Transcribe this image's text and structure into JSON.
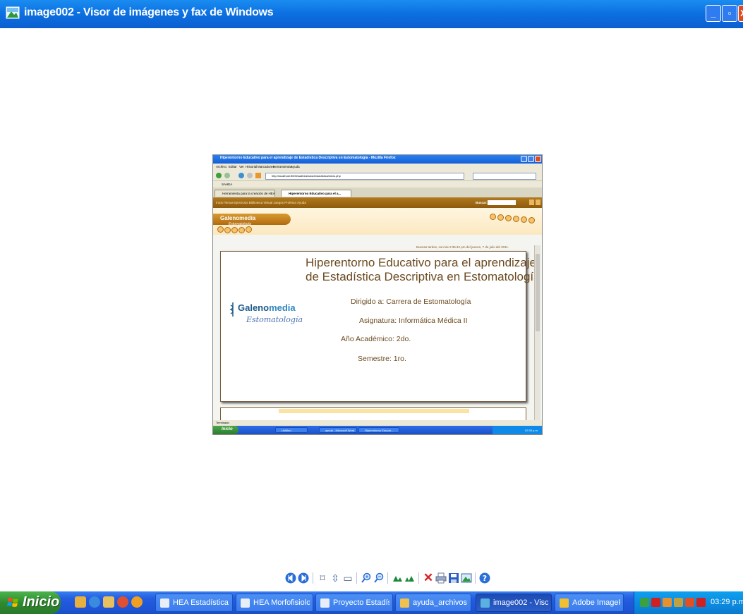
{
  "window": {
    "title": "image002 - Visor de imágenes y fax de Windows",
    "min_label": "_",
    "max_label": "▫",
    "close_label": "X"
  },
  "preview": {
    "firefox_title": "Hiperentorno Educativo para el aprendizaje de Estadística Descriptiva en Estomatología - Mozilla Firefox",
    "menu": [
      "Archivo",
      "Editar",
      "Ver",
      "Historial",
      "Marcadores",
      "Herramientas",
      "Ayuda"
    ],
    "url": "http://localhost:5000/sadhea/www/estadistica/inicio.php",
    "bookmark": "SAHEA",
    "tabs": [
      "Herramienta para la creación de HEA",
      "Hiperentorno Educativo para el a..."
    ],
    "site_nav": "Inicio   Temas   Ejercicios   Biblioteca Virtual   Juegos   Profesor   Ayuda",
    "search_label": "Buscar:",
    "header_logo": "Galenomedia",
    "header_sub": "Estomatología",
    "greeting": "Buenas tardes, son las 2:35:42 pm del jueves, 7 de julio del 2011.",
    "main_title_1": "Hiperentorno Educativo para el aprendizaje",
    "main_title_2": "de Estadística Descriptiva en Estomatología",
    "logo_galeno": "Galeno",
    "logo_media": "media",
    "logo_sub": "Estomatología",
    "dirigido": "Dirigido a: Carrera de Estomatología",
    "asignatura": "Asignatura: Informática Médica II",
    "anio": "Año Académico: 2do.",
    "semestre": "Semestre: 1ro.",
    "status": "Terminado",
    "inner_start": "Inicio",
    "inner_tasks": [
      "Untitled",
      "ayuda - Microsoft Word",
      "Hiperentorno Educat..."
    ],
    "inner_clock": "02:35 p.m."
  },
  "toolbar": {
    "icons": [
      "previous-image-icon",
      "next-image-icon",
      "best-fit-icon",
      "actual-size-icon",
      "slideshow-icon",
      "zoom-in-icon",
      "zoom-out-icon",
      "rotate-clockwise-icon",
      "rotate-counterclockwise-icon",
      "delete-icon",
      "print-icon",
      "save-icon",
      "edit-icon",
      "help-icon"
    ]
  },
  "taskbar": {
    "start_label": "Inicio",
    "tasks": [
      "HEA Estadística ...",
      "HEA Morfofisiolo...",
      "Proyecto Estadís...",
      "ayuda_archivos",
      "image002 - Visor...",
      "Adobe ImageRe..."
    ],
    "clock": "03:29 p.m."
  },
  "colors": {
    "titlebar": "#0c6fe0",
    "taskbar": "#245ee0",
    "start": "#2f8a2f",
    "tray": "#0c8ce0",
    "brown_text": "#6b4a20"
  }
}
